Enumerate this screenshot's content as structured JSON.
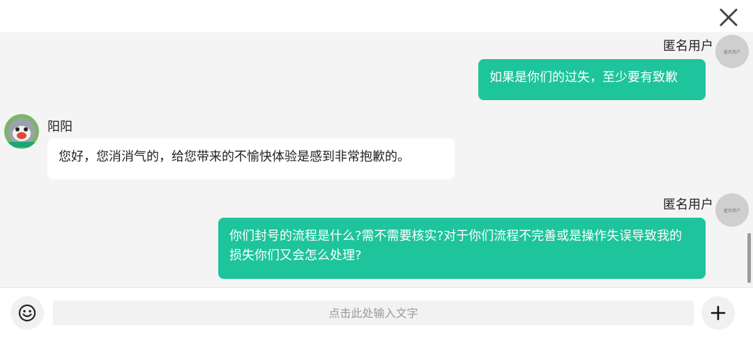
{
  "header": {
    "close_icon": "close-icon"
  },
  "messages": [
    {
      "sender": "匿名用户",
      "avatar_text": "匿名用户",
      "side": "right",
      "text": "如果是你们的过失，至少要有致歉"
    },
    {
      "sender": "阳阳",
      "avatar_icon": "bot-avatar-icon",
      "side": "left",
      "text": "您好，您消消气的，给您带来的不愉快体验是感到非常抱歉的。"
    },
    {
      "sender": "匿名用户",
      "avatar_text": "匿名用户",
      "side": "right",
      "text": "你们封号的流程是什么?需不需要核实?对于你们流程不完善或是操作失误导致我的损失你们又会怎么处理?"
    }
  ],
  "composer": {
    "placeholder": "点击此处输入文字",
    "emoji_icon": "emoji-icon",
    "add_icon": "plus-icon"
  },
  "colors": {
    "accent": "#1ec49b",
    "chat_bg": "#f4f4f4"
  }
}
